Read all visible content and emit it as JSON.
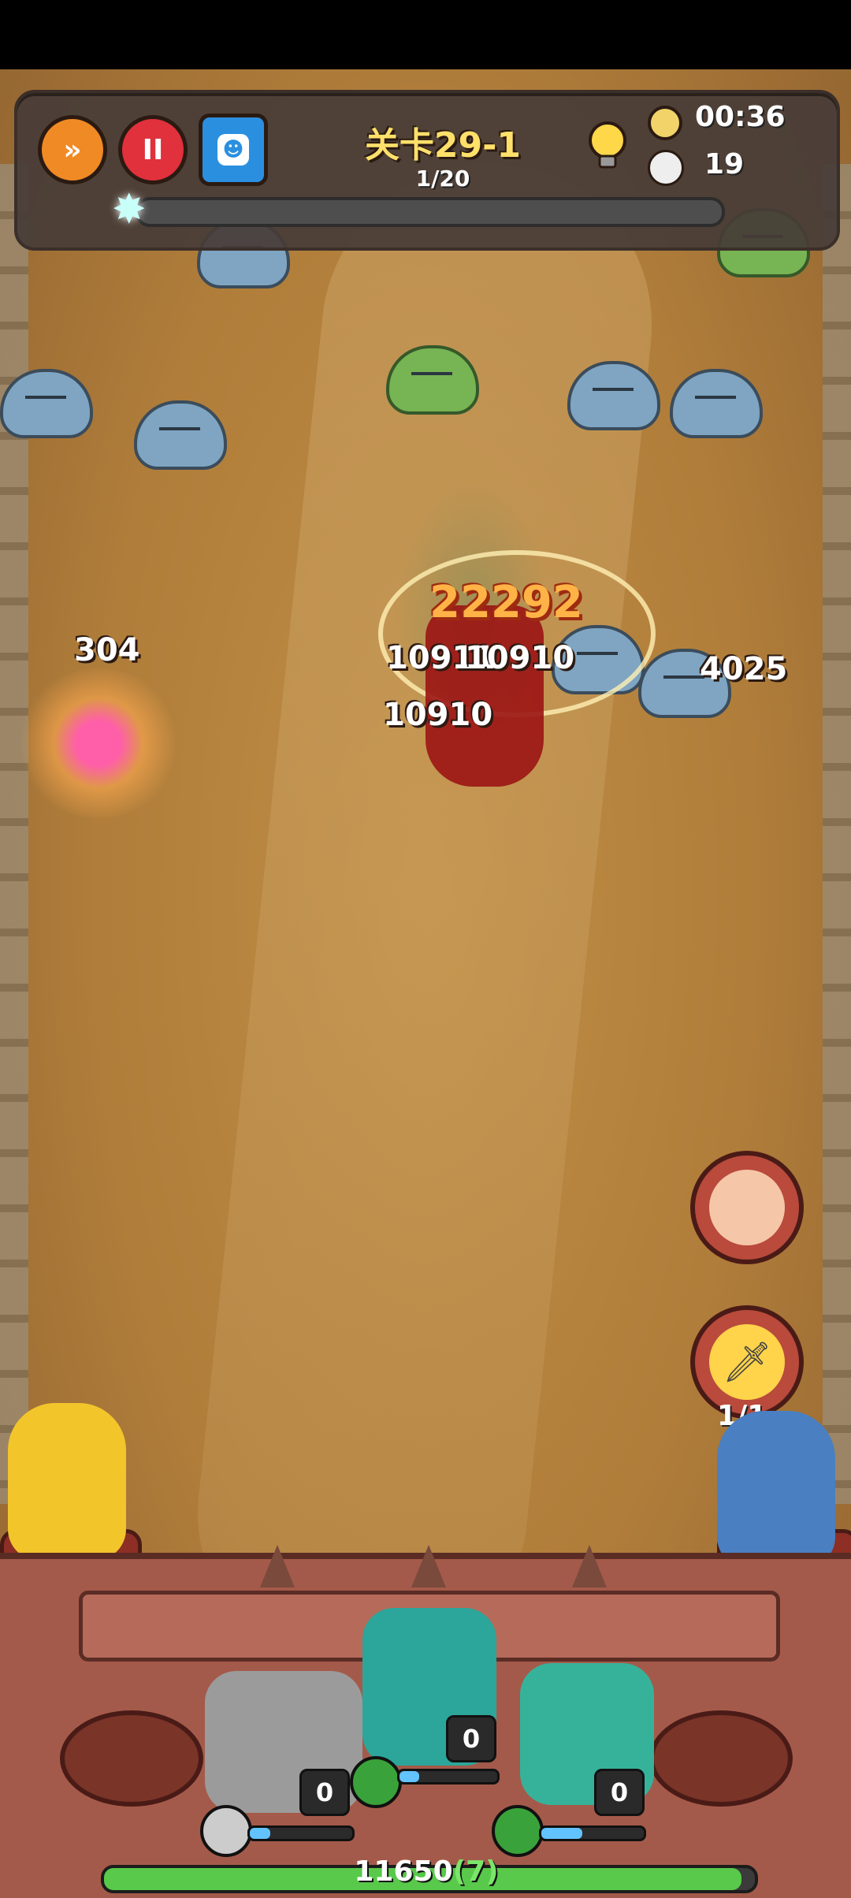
{
  "hud": {
    "stage": "关卡29-1",
    "wave": "1/20",
    "timer": "00:36",
    "kills": "19",
    "wave_progress": 0.0,
    "buttons": {
      "fast_forward": "»",
      "pause": "II"
    }
  },
  "damage_numbers": {
    "d1": "304",
    "d2": "22292",
    "d3": "10911",
    "d4": "10910",
    "d5": "10910",
    "d6": "4025"
  },
  "skills": {
    "charges": "1/1"
  },
  "heroes": [
    {
      "level": "0",
      "mana": 0.2
    },
    {
      "level": "0",
      "mana": 0.2
    },
    {
      "level": "0",
      "mana": 0.4
    }
  ],
  "base": {
    "hp": "11650",
    "stacks": "(7)",
    "hp_fill": 0.98
  },
  "colors": {
    "stage_title": "#ffe06a",
    "hp_bar": "#58c94a",
    "mana_bar": "#62c3ff",
    "crit_damage": "#ffb347"
  }
}
